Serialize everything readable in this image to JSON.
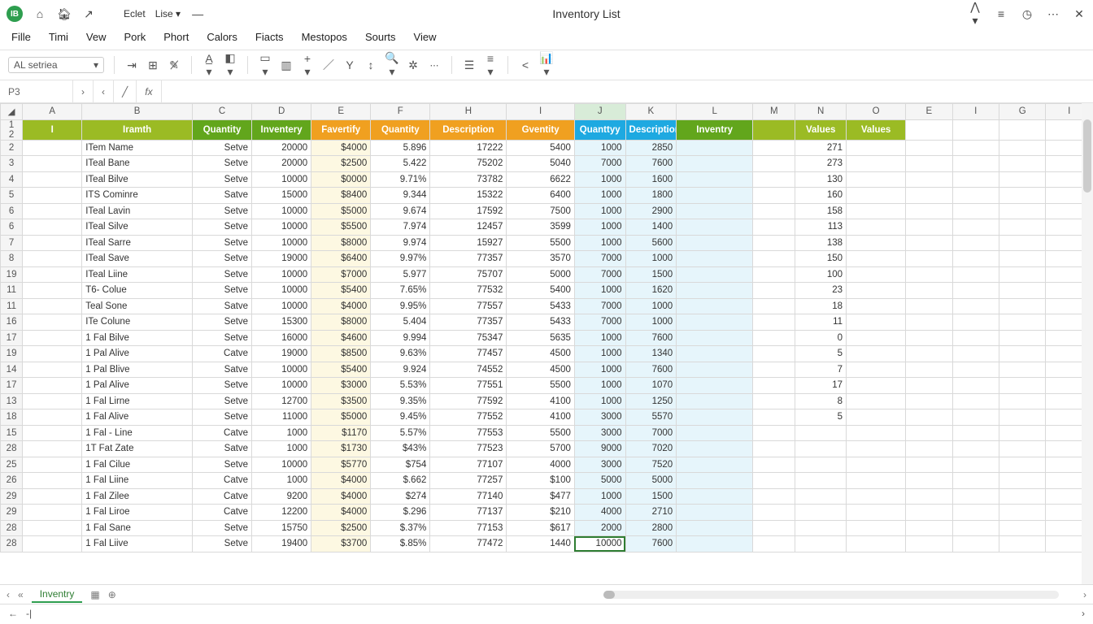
{
  "title": "Inventory List",
  "app_initials": "IB",
  "doc_menu": [
    "Eclet",
    "Lise"
  ],
  "menus": [
    "Fille",
    "Timi",
    "Vew",
    "Pork",
    "Phort",
    "Calors",
    "Fiacts",
    "Mestopos",
    "Sourts",
    "View"
  ],
  "namebox": "AL setriea",
  "fx_cell": "P3",
  "colletters": [
    "A",
    "B",
    "C",
    "D",
    "E",
    "F",
    "H",
    "I",
    "J",
    "K",
    "L",
    "M",
    "N",
    "O",
    "E",
    "I",
    "G",
    "I"
  ],
  "sel_col_index": 9,
  "headers": {
    "a": "I",
    "b": "Iramth",
    "c": "Quantity",
    "d": "Inventery",
    "e": "Favertify",
    "f": "Quantity",
    "h": "Description",
    "i": "Gventity",
    "j": "Quanttyy",
    "k": "Description",
    "l": "Inventry",
    "n": "Values",
    "o": "Values"
  },
  "rows": [
    {
      "r": "2",
      "b": "ITem Name",
      "c": "Setve",
      "d": "20000",
      "e": "$4000",
      "f": "5.896",
      "h": "17222",
      "i": "5400",
      "j": "1000",
      "k": "2850",
      "n": "271"
    },
    {
      "r": "3",
      "b": "ITeal Bane",
      "c": "Setve",
      "d": "20000",
      "e": "$2500",
      "f": "5.422",
      "h": "75202",
      "i": "5040",
      "j": "7000",
      "k": "7600",
      "n": "273"
    },
    {
      "r": "4",
      "b": "ITeal Bilve",
      "c": "Setve",
      "d": "10000",
      "e": "$0000",
      "f": "9.71%",
      "h": "73782",
      "i": "6622",
      "j": "1000",
      "k": "1600",
      "n": "130"
    },
    {
      "r": "5",
      "b": "ITS Cominre",
      "c": "Satve",
      "d": "15000",
      "e": "$8400",
      "f": "9.344",
      "h": "15322",
      "i": "6400",
      "j": "1000",
      "k": "1800",
      "n": "160"
    },
    {
      "r": "6",
      "b": "ITeal Lavin",
      "c": "Setve",
      "d": "10000",
      "e": "$5000",
      "f": "9.674",
      "h": "17592",
      "i": "7500",
      "j": "1000",
      "k": "2900",
      "n": "158"
    },
    {
      "r": "6",
      "b": "ITeal Silve",
      "c": "Setve",
      "d": "10000",
      "e": "$5500",
      "f": "7.974",
      "h": "12457",
      "i": "3599",
      "j": "1000",
      "k": "1400",
      "n": "113"
    },
    {
      "r": "7",
      "b": "ITeal Sarre",
      "c": "Setve",
      "d": "10000",
      "e": "$8000",
      "f": "9.974",
      "h": "15927",
      "i": "5500",
      "j": "1000",
      "k": "5600",
      "n": "138"
    },
    {
      "r": "8",
      "b": "ITeal Save",
      "c": "Setve",
      "d": "19000",
      "e": "$6400",
      "f": "9.97%",
      "h": "77357",
      "i": "3570",
      "j": "7000",
      "k": "1000",
      "n": "150"
    },
    {
      "r": "19",
      "b": "ITeal Liine",
      "c": "Setve",
      "d": "10000",
      "e": "$7000",
      "f": "5.977",
      "h": "75707",
      "i": "5000",
      "j": "7000",
      "k": "1500",
      "n": "100"
    },
    {
      "r": "11",
      "b": "T6- Colue",
      "c": "Setve",
      "d": "10000",
      "e": "$5400",
      "f": "7.65%",
      "h": "77532",
      "i": "5400",
      "j": "1000",
      "k": "1620",
      "n": "23"
    },
    {
      "r": "11",
      "b": "Teal Sone",
      "c": "Satve",
      "d": "10000",
      "e": "$4000",
      "f": "9.95%",
      "h": "77557",
      "i": "5433",
      "j": "7000",
      "k": "1000",
      "n": "18"
    },
    {
      "r": "16",
      "b": "ITe Colune",
      "c": "Setve",
      "d": "15300",
      "e": "$8000",
      "f": "5.404",
      "h": "77357",
      "i": "5433",
      "j": "7000",
      "k": "1000",
      "n": "11"
    },
    {
      "r": "17",
      "b": "1 Fal Bilve",
      "c": "Setve",
      "d": "16000",
      "e": "$4600",
      "f": "9.994",
      "h": "75347",
      "i": "5635",
      "j": "1000",
      "k": "7600",
      "n": "0"
    },
    {
      "r": "19",
      "b": "1 Pal Alive",
      "c": "Catve",
      "d": "19000",
      "e": "$8500",
      "f": "9.63%",
      "h": "77457",
      "i": "4500",
      "j": "1000",
      "k": "1340",
      "n": "5"
    },
    {
      "r": "14",
      "b": "1 Pal Blive",
      "c": "Satve",
      "d": "10000",
      "e": "$5400",
      "f": "9.924",
      "h": "74552",
      "i": "4500",
      "j": "1000",
      "k": "7600",
      "n": "7"
    },
    {
      "r": "17",
      "b": "1 Pal Alive",
      "c": "Setve",
      "d": "10000",
      "e": "$3000",
      "f": "5.53%",
      "h": "77551",
      "i": "5500",
      "j": "1000",
      "k": "1070",
      "n": "17"
    },
    {
      "r": "13",
      "b": "1 Fal Lirne",
      "c": "Setve",
      "d": "12700",
      "e": "$3500",
      "f": "9.35%",
      "h": "77592",
      "i": "4100",
      "j": "1000",
      "k": "1250",
      "n": "8"
    },
    {
      "r": "18",
      "b": "1 Fal Alive",
      "c": "Setve",
      "d": "11000",
      "e": "$5000",
      "f": "9.45%",
      "h": "77552",
      "i": "4100",
      "j": "3000",
      "k": "5570",
      "n": "5"
    },
    {
      "r": "15",
      "b": "1 Fal - Line",
      "c": "Catve",
      "d": "1000",
      "e": "$1170",
      "f": "5.57%",
      "h": "77553",
      "i": "5500",
      "j": "3000",
      "k": "7000",
      "n": ""
    },
    {
      "r": "28",
      "b": "1T Fat Zate",
      "c": "Satve",
      "d": "1000",
      "e": "$1730",
      "f": "$43%",
      "h": "77523",
      "i": "5700",
      "j": "9000",
      "k": "7020",
      "n": ""
    },
    {
      "r": "25",
      "b": "1 Fal Cilue",
      "c": "Setve",
      "d": "10000",
      "e": "$5770",
      "f": "$754",
      "h": "77107",
      "i": "4000",
      "j": "3000",
      "k": "7520",
      "n": ""
    },
    {
      "r": "26",
      "b": "1 Fal Liine",
      "c": "Catve",
      "d": "1000",
      "e": "$4000",
      "f": "$.662",
      "h": "77257",
      "i": "$100",
      "j": "5000",
      "k": "5000",
      "n": ""
    },
    {
      "r": "29",
      "b": "1 Fal Zilee",
      "c": "Catve",
      "d": "9200",
      "e": "$4000",
      "f": "$274",
      "h": "77140",
      "i": "$477",
      "j": "1000",
      "k": "1500",
      "n": ""
    },
    {
      "r": "29",
      "b": "1 Fal Liroe",
      "c": "Catve",
      "d": "12200",
      "e": "$4000",
      "f": "$.296",
      "h": "77137",
      "i": "$210",
      "j": "4000",
      "k": "2710",
      "n": ""
    },
    {
      "r": "28",
      "b": "1 Fal Sane",
      "c": "Setve",
      "d": "15750",
      "e": "$2500",
      "f": "$.37%",
      "h": "77153",
      "i": "$617",
      "j": "2000",
      "k": "2800",
      "n": ""
    },
    {
      "r": "28",
      "b": "1 Fal Liive",
      "c": "Setve",
      "d": "19400",
      "e": "$3700",
      "f": "$.85%",
      "h": "77472",
      "i": "1440",
      "j": "10000",
      "k": "7600",
      "n": ""
    }
  ],
  "sheet_tab": "Inventry",
  "status_left_icons": [
    "←",
    "-|"
  ],
  "colors": {
    "olive": "#9bbb24",
    "green": "#62a61c",
    "orange": "#f0a020",
    "blue": "#1ea9e1"
  }
}
